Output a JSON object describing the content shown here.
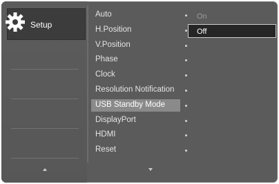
{
  "sidebar": {
    "setup_label": "Setup",
    "icon": "gear-icon"
  },
  "menu": {
    "items": [
      {
        "label": "Auto"
      },
      {
        "label": "H.Position"
      },
      {
        "label": "V.Position"
      },
      {
        "label": "Phase"
      },
      {
        "label": "Clock"
      },
      {
        "label": "Resolution Notification"
      },
      {
        "label": "USB Standby Mode"
      },
      {
        "label": "DisplayPort"
      },
      {
        "label": "HDMI"
      },
      {
        "label": "Reset"
      }
    ],
    "selected_item": "USB Standby Mode"
  },
  "submenu": {
    "on_label": "On",
    "selected_option": "Off"
  },
  "colors": {
    "panel": "#5b5b5b",
    "selected_row": "#8a8a8a",
    "setup_highlight": "#3c3c3c",
    "option_box": "#262626"
  }
}
